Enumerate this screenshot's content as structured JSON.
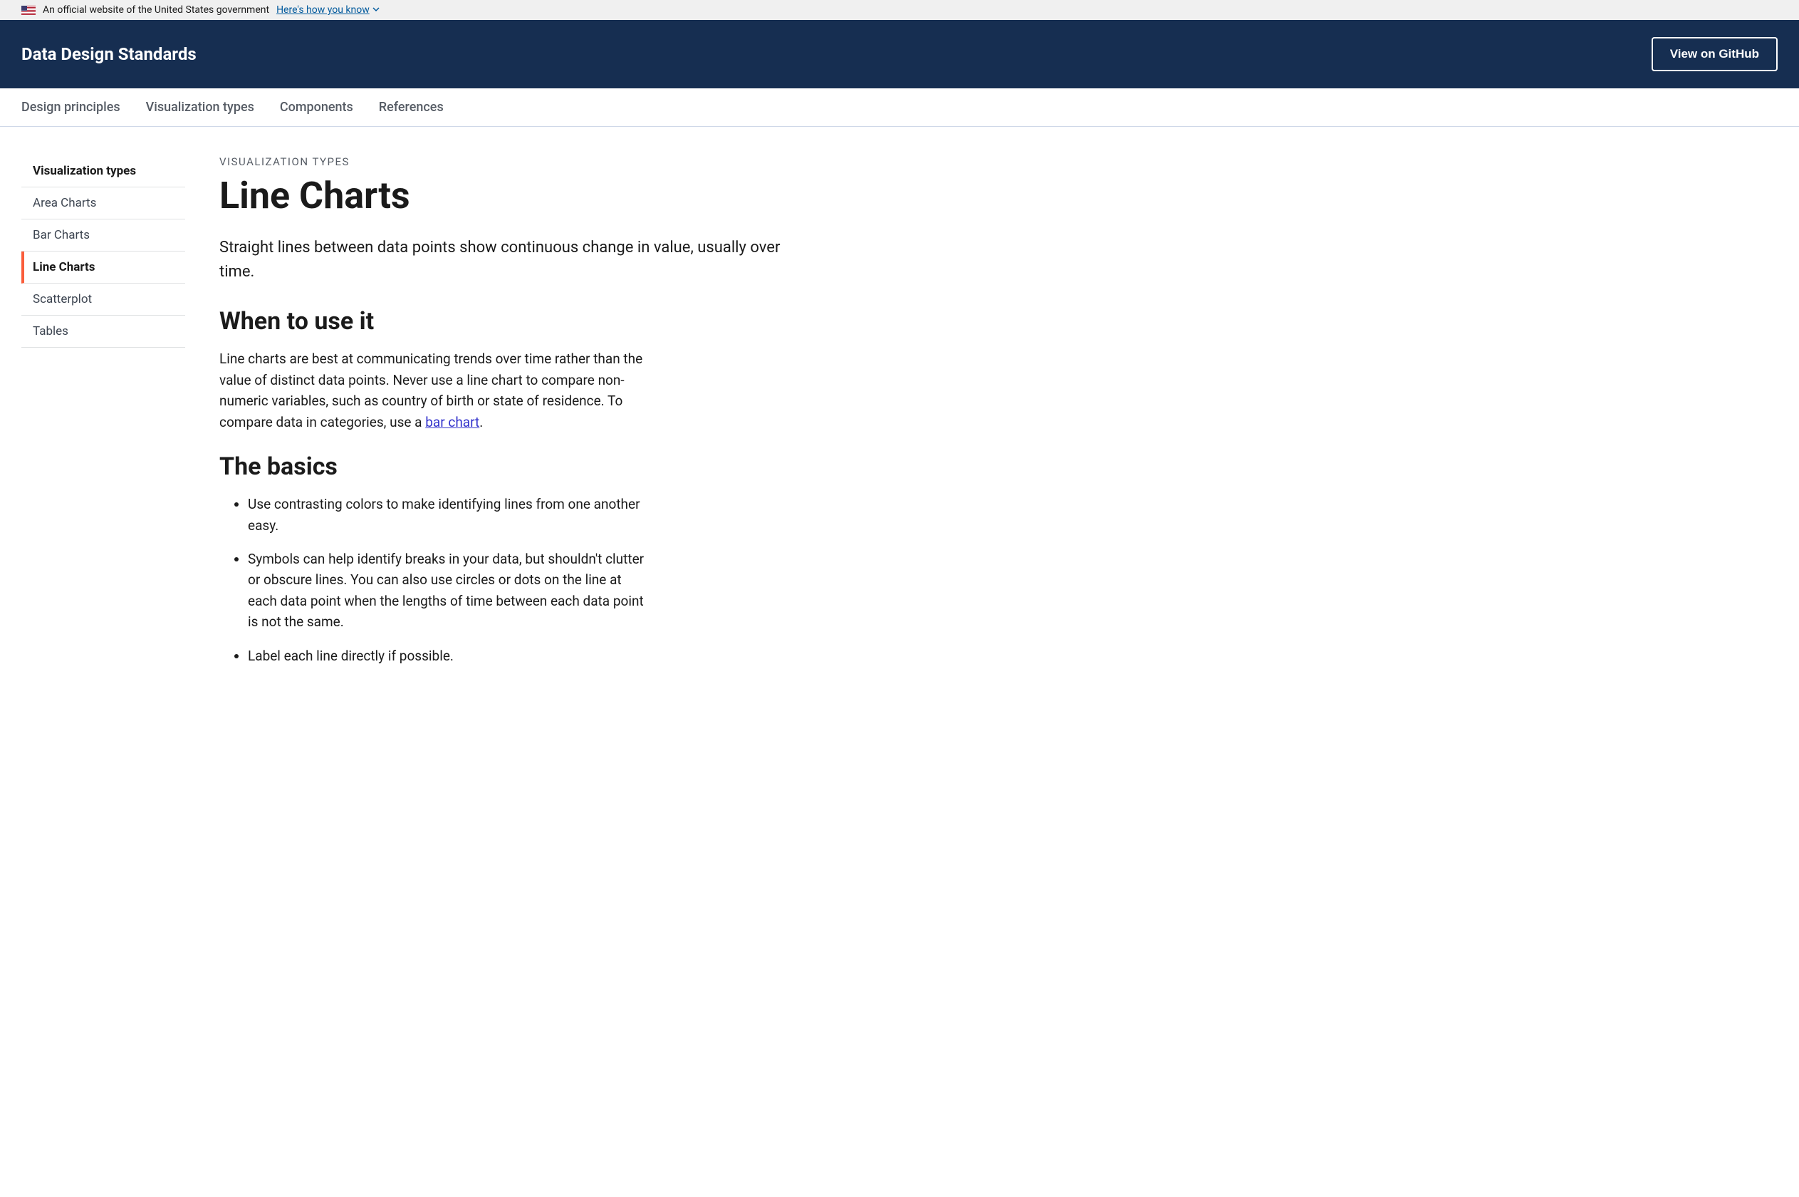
{
  "gov_banner": {
    "text": "An official website of the United States government",
    "toggle": "Here's how you know"
  },
  "header": {
    "title": "Data Design Standards",
    "github_button": "View on GitHub"
  },
  "primary_nav": [
    "Design principles",
    "Visualization types",
    "Components",
    "References"
  ],
  "sidebar": [
    "Visualization types",
    "Area Charts",
    "Bar Charts",
    "Line Charts",
    "Scatterplot",
    "Tables"
  ],
  "main": {
    "eyebrow": "VISUALIZATION TYPES",
    "title": "Line Charts",
    "intro": "Straight lines between data points show continuous change in value, usually over time.",
    "when_heading": "When to use it",
    "when_text_before_link": "Line charts are best at communicating trends over time rather than the value of distinct data points. Never use a line chart to compare non-numeric variables, such as country of birth or state of residence. To compare data in categories, use a ",
    "when_link_text": "bar chart",
    "when_text_after_link": ".",
    "basics_heading": "The basics",
    "basics_list": [
      "Use contrasting colors to make identifying lines from one another easy.",
      "Symbols can help identify breaks in your data, but shouldn't clutter or obscure lines. You can also use circles or dots on the line at each data point when the lengths of time between each data point is not the same.",
      "Label each line directly if possible."
    ]
  }
}
